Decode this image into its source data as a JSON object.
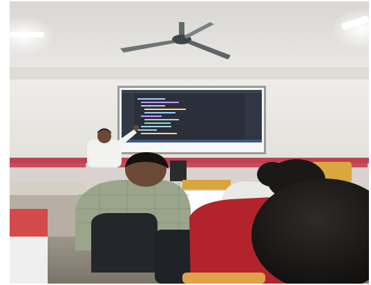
{
  "photo": {
    "subject": "classroom-presentation",
    "palette": {
      "ceiling": "#e4e2de",
      "wall": "#ecebe6",
      "screen": "#f7f7f5",
      "code_editor_bg": "#2b2f3a",
      "code_text": "#9fd3ff",
      "trim_red": "#c0414f",
      "presenter_shirt": "#f2f2ef",
      "student_shirt_check": "#9aa58c",
      "student_shirt_red": "#b2232b",
      "chair": "#23262b",
      "floor": "#8b8476"
    },
    "icons": [
      "ceiling-fan-icon",
      "ceiling-light-icon"
    ]
  }
}
